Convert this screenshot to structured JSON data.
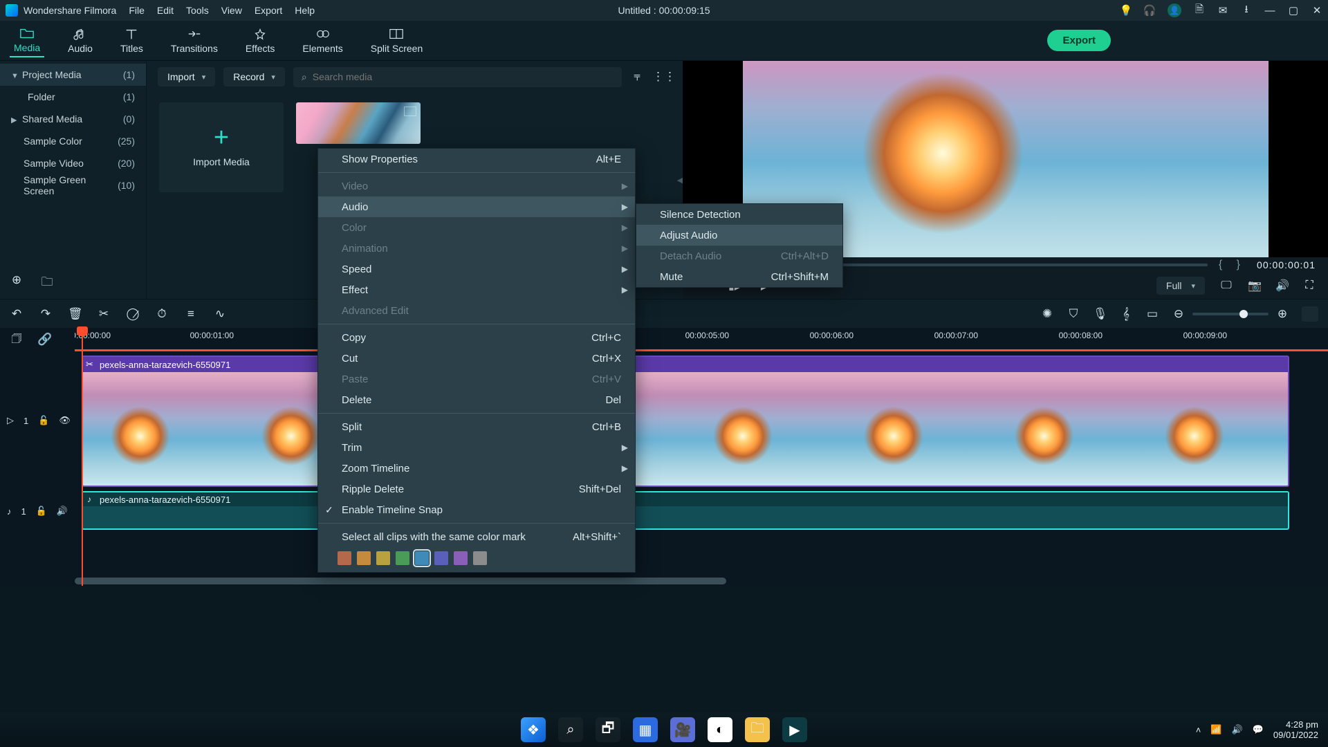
{
  "titlebar": {
    "app_name": "Wondershare Filmora",
    "menus": [
      "File",
      "Edit",
      "Tools",
      "View",
      "Export",
      "Help"
    ],
    "document": "Untitled : 00:00:09:15"
  },
  "tabs": {
    "items": [
      {
        "label": "Media",
        "active": true
      },
      {
        "label": "Audio"
      },
      {
        "label": "Titles"
      },
      {
        "label": "Transitions"
      },
      {
        "label": "Effects"
      },
      {
        "label": "Elements"
      },
      {
        "label": "Split Screen"
      }
    ],
    "export": "Export"
  },
  "sidebar": {
    "items": [
      {
        "label": "Project Media",
        "count": "(1)",
        "header": true,
        "caret": "▼"
      },
      {
        "label": "Folder",
        "count": "(1)",
        "indent": true
      },
      {
        "label": "Shared Media",
        "count": "(0)",
        "caret": "▶"
      },
      {
        "label": "Sample Color",
        "count": "(25)"
      },
      {
        "label": "Sample Video",
        "count": "(20)"
      },
      {
        "label": "Sample Green Screen",
        "count": "(10)"
      }
    ]
  },
  "bin": {
    "import": "Import",
    "record": "Record",
    "search_placeholder": "Search media",
    "import_card": "Import Media"
  },
  "preview": {
    "time": "00:00:00:01",
    "quality": "Full"
  },
  "timeline": {
    "ticks": [
      "00:00:00:00",
      "00:00:01:00",
      "",
      "",
      "",
      "00:00:05:00",
      "00:00:06:00",
      "00:00:07:00",
      "00:00:08:00",
      "00:00:09:00"
    ],
    "video_clip": "pexels-anna-tarazevich-6550971",
    "audio_clip": "pexels-anna-tarazevich-6550971",
    "video_track": "1",
    "audio_track": "1"
  },
  "context": {
    "show_properties": "Show Properties",
    "show_properties_sc": "Alt+E",
    "video": "Video",
    "audio": "Audio",
    "color": "Color",
    "animation": "Animation",
    "speed": "Speed",
    "effect": "Effect",
    "advanced": "Advanced Edit",
    "copy": "Copy",
    "copy_sc": "Ctrl+C",
    "cut": "Cut",
    "cut_sc": "Ctrl+X",
    "paste": "Paste",
    "paste_sc": "Ctrl+V",
    "delete": "Delete",
    "delete_sc": "Del",
    "split": "Split",
    "split_sc": "Ctrl+B",
    "trim": "Trim",
    "zoom": "Zoom Timeline",
    "ripple": "Ripple Delete",
    "ripple_sc": "Shift+Del",
    "snap": "Enable Timeline Snap",
    "select_color": "Select all clips with the same color mark",
    "select_color_sc": "Alt+Shift+`",
    "colors": [
      "#b46a4a",
      "#c58a3e",
      "#b8a13e",
      "#4a9a58",
      "#3e8ab8",
      "#5a5fba",
      "#8a5fba",
      "#8c8c8c"
    ],
    "color_sel_index": 4
  },
  "submenu": {
    "silence": "Silence Detection",
    "adjust": "Adjust Audio",
    "detach": "Detach Audio",
    "detach_sc": "Ctrl+Alt+D",
    "mute": "Mute",
    "mute_sc": "Ctrl+Shift+M"
  },
  "taskbar": {
    "time": "4:28 pm",
    "date": "09/01/2022"
  }
}
